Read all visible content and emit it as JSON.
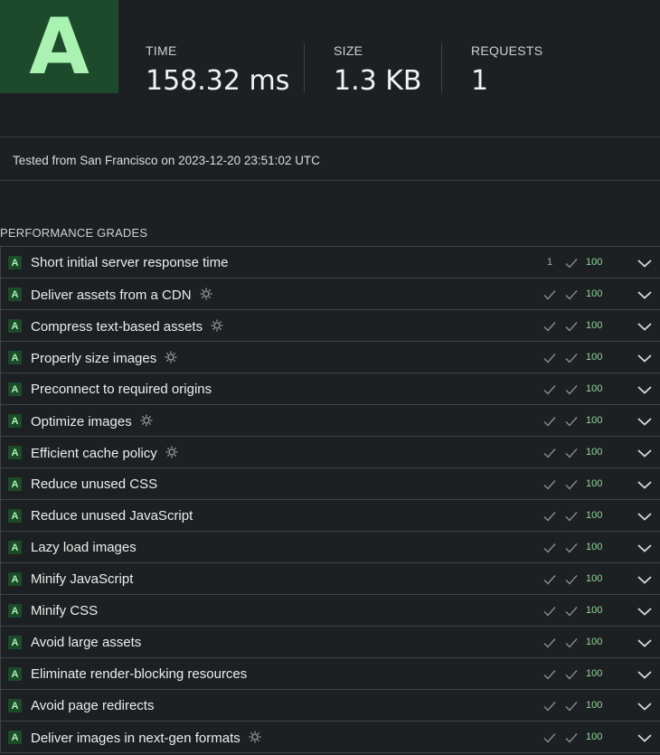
{
  "header": {
    "grade": "A",
    "metrics": [
      {
        "label": "TIME",
        "value": "158.32 ms"
      },
      {
        "label": "SIZE",
        "value": "1.3 KB"
      },
      {
        "label": "REQUESTS",
        "value": "1"
      }
    ]
  },
  "tested_text": "Tested from San Francisco on 2023-12-20 23:51:02 UTC",
  "section_title": "PERFORMANCE GRADES",
  "grades": [
    {
      "grade": "A",
      "title": "Short initial server response time",
      "count": "1",
      "score": "100",
      "cog": false
    },
    {
      "grade": "A",
      "title": "Deliver assets from a CDN",
      "count": "",
      "score": "100",
      "cog": true
    },
    {
      "grade": "A",
      "title": "Compress text-based assets",
      "count": "",
      "score": "100",
      "cog": true
    },
    {
      "grade": "A",
      "title": "Properly size images",
      "count": "",
      "score": "100",
      "cog": true
    },
    {
      "grade": "A",
      "title": "Preconnect to required origins",
      "count": "",
      "score": "100",
      "cog": false
    },
    {
      "grade": "A",
      "title": "Optimize images",
      "count": "",
      "score": "100",
      "cog": true
    },
    {
      "grade": "A",
      "title": "Efficient cache policy",
      "count": "",
      "score": "100",
      "cog": true
    },
    {
      "grade": "A",
      "title": "Reduce unused CSS",
      "count": "",
      "score": "100",
      "cog": false
    },
    {
      "grade": "A",
      "title": "Reduce unused JavaScript",
      "count": "",
      "score": "100",
      "cog": false
    },
    {
      "grade": "A",
      "title": "Lazy load images",
      "count": "",
      "score": "100",
      "cog": false
    },
    {
      "grade": "A",
      "title": "Minify JavaScript",
      "count": "",
      "score": "100",
      "cog": false
    },
    {
      "grade": "A",
      "title": "Minify CSS",
      "count": "",
      "score": "100",
      "cog": false
    },
    {
      "grade": "A",
      "title": "Avoid large assets",
      "count": "",
      "score": "100",
      "cog": false
    },
    {
      "grade": "A",
      "title": "Eliminate render-blocking resources",
      "count": "",
      "score": "100",
      "cog": false
    },
    {
      "grade": "A",
      "title": "Avoid page redirects",
      "count": "",
      "score": "100",
      "cog": false
    },
    {
      "grade": "A",
      "title": "Deliver images in next-gen formats",
      "count": "",
      "score": "100",
      "cog": true
    }
  ],
  "colors": {
    "background": "#1d2022",
    "grade_bg": "#1c4a2a",
    "grade_fg": "#a9f2b2",
    "score": "#8fd69a"
  },
  "icons": {
    "check": "check-icon",
    "cog": "cog-icon",
    "chevron": "chevron-down-icon"
  }
}
